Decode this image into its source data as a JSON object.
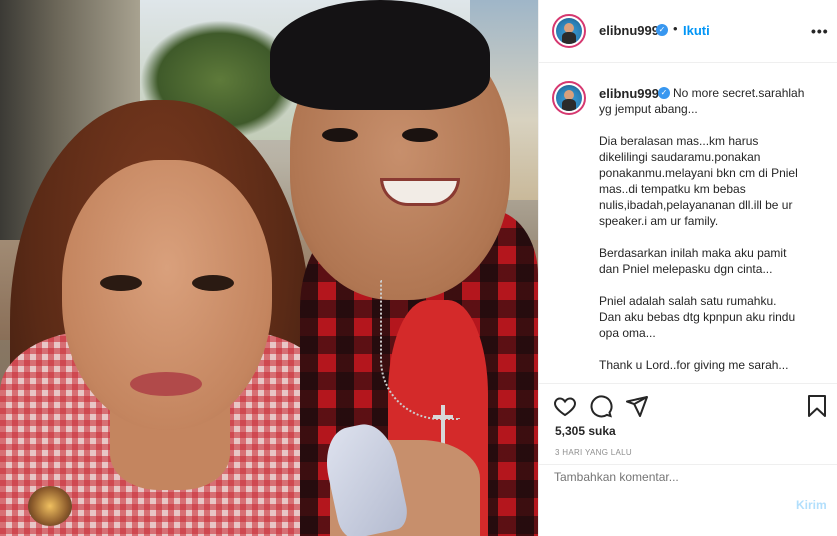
{
  "post": {
    "username": "elibnu999",
    "verified_mark": "✓",
    "separator": "•",
    "follow_label": "Ikuti",
    "more_icon": "•••",
    "caption_lines": [
      "No more secret.sarahlah",
      "yg jemput abang...",
      "",
      "Dia beralasan mas...km harus",
      "dikelilingi saudaramu.ponakan",
      "ponakanmu.melayani bkn cm di Pniel",
      "mas..di tempatku km bebas",
      "nulis,ibadah,pelayananan dll.ill be ur",
      "speaker.i am ur family.",
      "",
      "Berdasarkan inilah maka aku pamit",
      "dan Pniel melepasku dgn cinta...",
      "",
      "Pniel adalah salah satu rumahku.",
      "Dan aku bebas dtg kpnpun aku rindu",
      "opa oma...",
      "",
      "Thank u Lord..for giving me sarah..."
    ],
    "likes": "5,305 suka",
    "time": "3 HARI YANG LALU",
    "comment_placeholder": "Tambahkan komentar...",
    "post_button": "Kirim"
  },
  "icons": {
    "like": "heart-icon",
    "comment": "comment-icon",
    "share": "share-icon",
    "save": "bookmark-icon"
  },
  "colors": {
    "accent": "#0095f6",
    "verified": "#3897f0",
    "post_disabled": "#b2dffc",
    "avatar_ring": "#d63870"
  }
}
